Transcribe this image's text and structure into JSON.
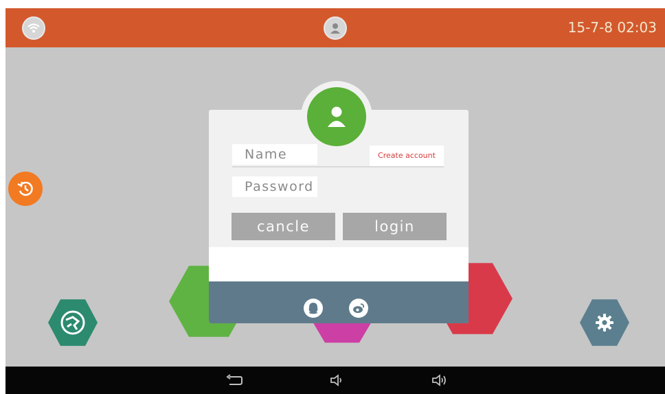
{
  "status_bar": {
    "datetime": "15-7-8 02:03",
    "accent_color": "#d3592d"
  },
  "icons": {
    "wifi": "wifi-icon",
    "user": "user-icon",
    "history": "history-icon",
    "map": "map-icon",
    "settings": "gear-icon",
    "qq": "qq-icon",
    "weibo": "weibo-icon",
    "back": "back-icon",
    "volume_down": "volume-down-icon",
    "volume_up": "volume-up-icon"
  },
  "login": {
    "name_placeholder": "Name",
    "password_placeholder": "Password",
    "create_account": "Create account",
    "cancel_label": "cancle",
    "login_label": "login"
  },
  "colors": {
    "avatar_green": "#5ab038",
    "history_orange": "#f27a22",
    "footer_slate": "#5f7b8b",
    "create_account_red": "#d63b3b"
  }
}
